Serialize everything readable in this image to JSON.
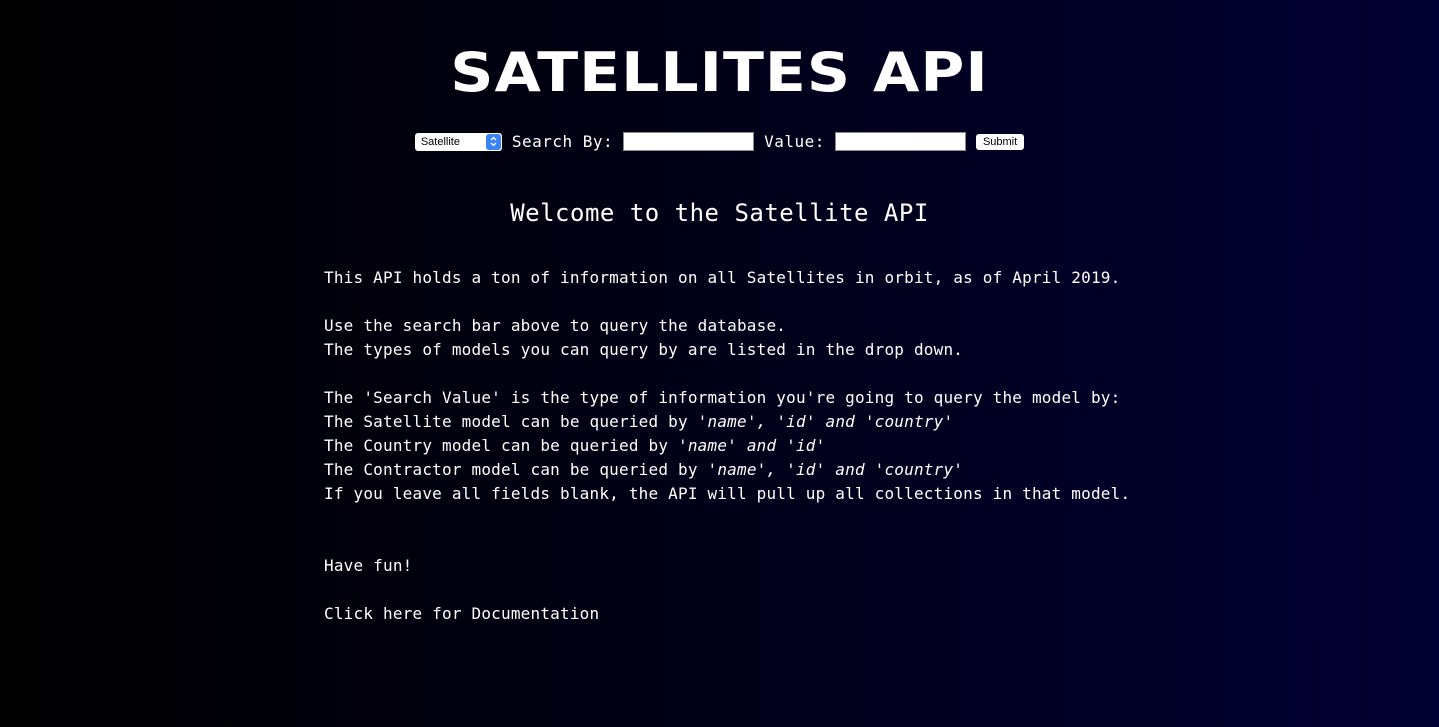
{
  "header": {
    "title": "SATELLITES API"
  },
  "search": {
    "model_select": {
      "selected": "Satellite",
      "icon": "updown-chevron-icon"
    },
    "search_by_label": "Search By:",
    "search_by_value": "",
    "value_label": "Value:",
    "value_value": "",
    "submit_label": "Submit"
  },
  "main": {
    "heading": "Welcome to the Satellite API",
    "intro": "This API holds a ton of information on all Satellites in orbit, as of April 2019.",
    "usage_line_1": "Use the search bar above to query the database.",
    "usage_line_2": "The types of models you can query by are listed in the drop down.",
    "search_value_line": "The 'Search Value' is the type of information you're going to query the model by:",
    "satellite_prefix": "The Satellite model can be queried by ",
    "satellite_fields": "'name', 'id' and 'country'",
    "country_prefix": "The Country model can be queried by ",
    "country_fields": "'name' and 'id'",
    "contractor_prefix": "The Contractor model can be queried by ",
    "contractor_fields": "'name', 'id' and 'country'",
    "blank_note": "If you leave all fields blank, the API will pull up all collections in that model.",
    "sign_off": "Have fun!",
    "docs_link": "Click here for Documentation"
  },
  "colors": {
    "background_left": "#000000",
    "background_right": "#030033",
    "text": "#ffffff",
    "select_accent": "#3b82f6"
  }
}
